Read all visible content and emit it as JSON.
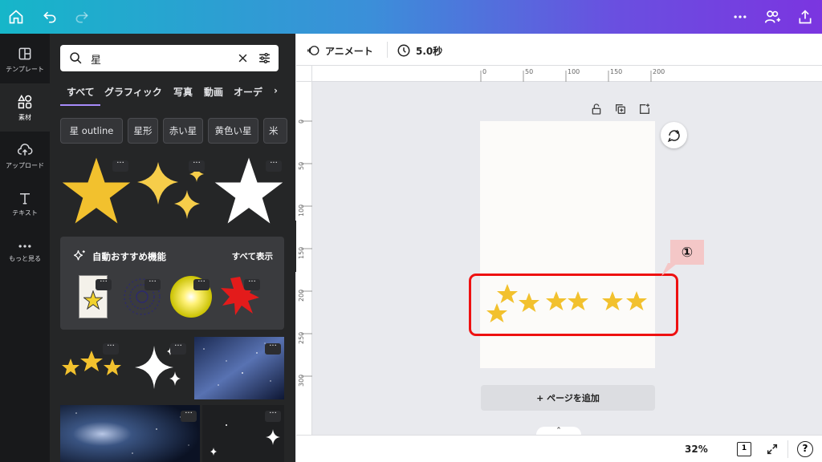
{
  "topbar": {
    "icons": [
      "home-icon",
      "undo-icon",
      "redo-icon",
      "more-icon",
      "share-people-icon",
      "upload-icon"
    ]
  },
  "rail": {
    "items": [
      {
        "label": "テンプレート",
        "icon": "template-icon"
      },
      {
        "label": "素材",
        "icon": "elements-icon"
      },
      {
        "label": "アップロード",
        "icon": "upload-cloud-icon"
      },
      {
        "label": "テキスト",
        "icon": "text-icon"
      },
      {
        "label": "もっと見る",
        "icon": "more-dots-icon"
      }
    ]
  },
  "panel": {
    "search": {
      "query": "星"
    },
    "tabs": [
      "すべて",
      "グラフィック",
      "写真",
      "動画",
      "オーデ"
    ],
    "chips": [
      "星 outline",
      "星形",
      "赤い星",
      "黄色い星",
      "米"
    ],
    "recommend": {
      "title": "自動おすすめ機能",
      "see_all": "すべて表示"
    }
  },
  "toolbar": {
    "animate": "アニメート",
    "duration": "5.0秒"
  },
  "ruler": {
    "h": [
      "0",
      "50",
      "100",
      "150",
      "200"
    ],
    "v": [
      "0",
      "50",
      "100",
      "150",
      "200",
      "250",
      "300"
    ]
  },
  "canvas": {
    "add_page": "+ ページを追加"
  },
  "annotation": {
    "callout": "①"
  },
  "bottom": {
    "zoom": "32%",
    "page_num": "1",
    "help": "?"
  },
  "colors": {
    "star_yellow": "#f2c12e",
    "accent": "#8b3dff",
    "annotation_red": "#e11111"
  }
}
